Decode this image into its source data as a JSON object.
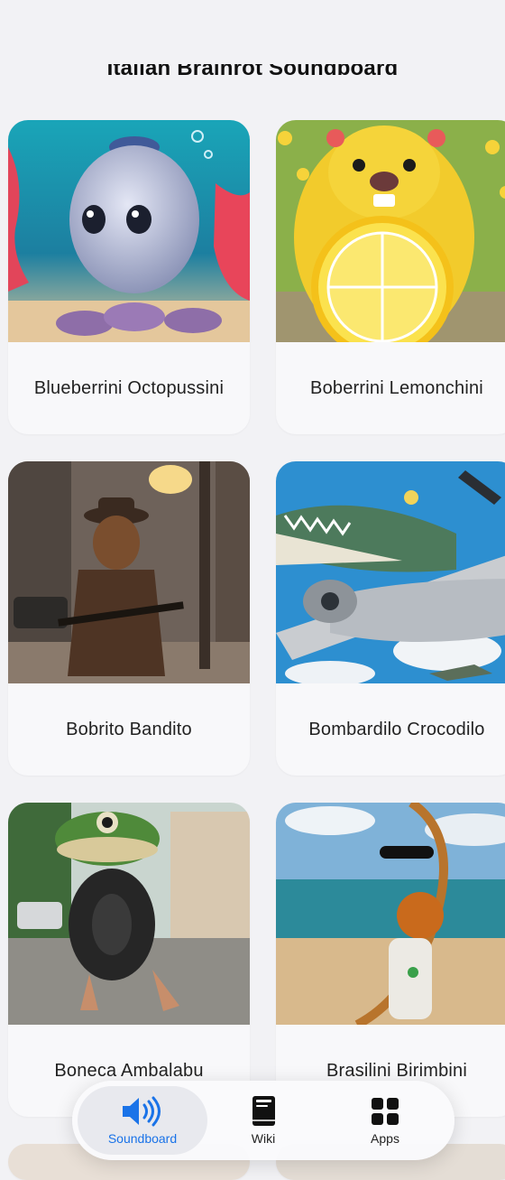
{
  "header": {
    "title": "Italian Brainrot Soundboard"
  },
  "cards": [
    {
      "name": "Blueberrini Octopussini"
    },
    {
      "name": "Boberrini Lemonchini"
    },
    {
      "name": "Bobrito Bandito"
    },
    {
      "name": "Bombardilo Crocodilo"
    },
    {
      "name": "Boneca Ambalabu"
    },
    {
      "name": "Brasilini Birimbini"
    }
  ],
  "tabbar": {
    "tabs": [
      {
        "label": "Soundboard",
        "icon": "speaker-icon",
        "active": true
      },
      {
        "label": "Wiki",
        "icon": "book-icon",
        "active": false
      },
      {
        "label": "Apps",
        "icon": "grid-icon",
        "active": false
      }
    ],
    "accent": "#1a73e8"
  }
}
